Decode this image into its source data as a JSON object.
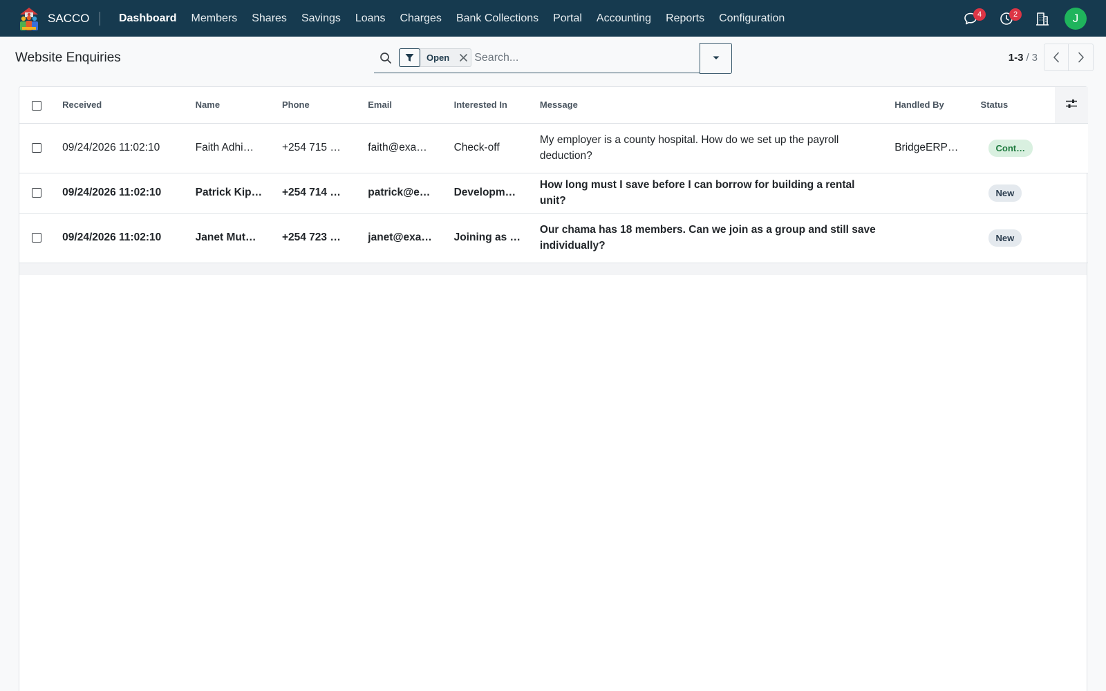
{
  "navbar": {
    "brand": "SACCO",
    "menu": [
      "Dashboard",
      "Members",
      "Shares",
      "Savings",
      "Loans",
      "Charges",
      "Bank Collections",
      "Portal",
      "Accounting",
      "Reports",
      "Configuration"
    ],
    "messages_count": "4",
    "activities_count": "2",
    "avatar_initial": "J",
    "avatar_color": "#1fb45c"
  },
  "control": {
    "title": "Website Enquiries",
    "facet_value": "Open",
    "search_placeholder": "Search...",
    "pager_value": "1-3",
    "pager_sep": "/",
    "pager_limit": "3"
  },
  "table": {
    "headers": [
      "Received",
      "Name",
      "Phone",
      "Email",
      "Interested In",
      "Message",
      "Handled By",
      "Status"
    ],
    "rows": [
      {
        "received": "09/24/2026 11:02:10",
        "name": "Faith Adhi…",
        "phone": "+254 715 …",
        "email": "faith@exa…",
        "interested": "Check-off",
        "message": "My employer is a county hospital. How do we set up the payroll deduction?",
        "handled_by": "BridgeERP…",
        "status": "Cont…"
      },
      {
        "received": "09/24/2026 11:02:10",
        "name": "Patrick Kip…",
        "phone": "+254 714 …",
        "email": "patrick@e…",
        "interested": "Developm…",
        "message": "How long must I save before I can borrow for building a rental unit?",
        "handled_by": "",
        "status": "New"
      },
      {
        "received": "09/24/2026 11:02:10",
        "name": "Janet Mut…",
        "phone": "+254 723 …",
        "email": "janet@exa…",
        "interested": "Joining as …",
        "message": "Our chama has 18 members. Can we join as a group and still save individually?",
        "handled_by": "",
        "status": "New"
      }
    ]
  },
  "colors": {
    "navbar_bg": "#163a4f",
    "badge_red": "#dc3545",
    "status_contacted_bg": "#d9f0e0",
    "status_new_bg": "#e4e9ee"
  }
}
